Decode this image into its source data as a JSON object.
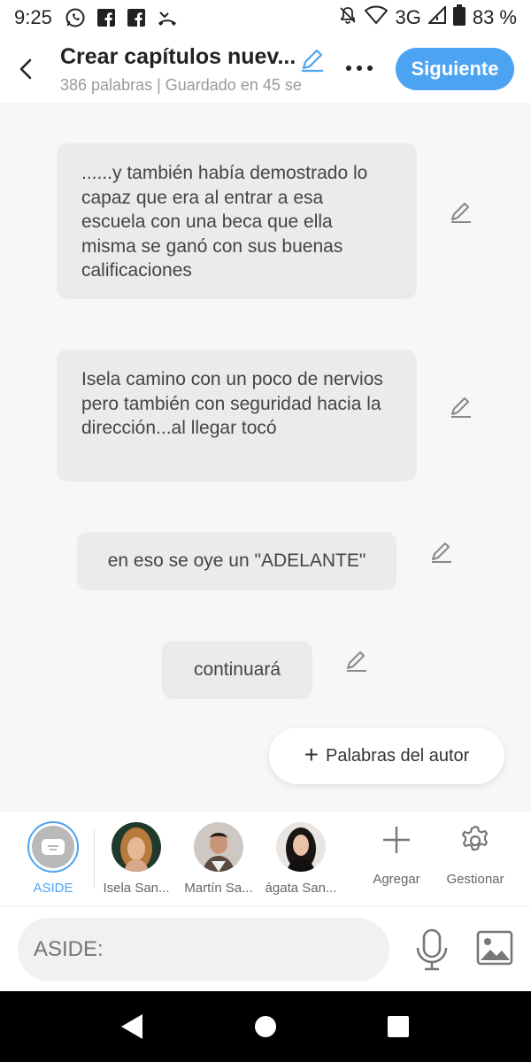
{
  "status_bar": {
    "time": "9:25",
    "network": "3G",
    "battery": "83 %"
  },
  "header": {
    "title": "Crear capítulos nuev...",
    "subtitle": "386 palabras | Guardado en 45 se",
    "next_label": "Siguiente"
  },
  "messages": [
    {
      "text": "......y también había demostrado lo capaz que era al entrar a esa escuela con una beca que ella misma se ganó con sus buenas calificaciones"
    },
    {
      "text": "Isela camino con un poco de nervios pero también con seguridad hacia la dirección...al llegar tocó"
    },
    {
      "text": "en eso se oye un \"ADELANTE\""
    },
    {
      "text": "continuará"
    }
  ],
  "author_words_button": "Palabras del autor",
  "characters": [
    {
      "label": "ASIDE",
      "active": true
    },
    {
      "label": "Isela San..."
    },
    {
      "label": "Martín Sa..."
    },
    {
      "label": "ágata San..."
    }
  ],
  "actions": {
    "add_label": "Agregar",
    "manage_label": "Gestionar"
  },
  "input": {
    "placeholder": "ASIDE:"
  },
  "colors": {
    "accent": "#4ba3f2",
    "bubble": "#ebebeb",
    "background": "#f7f7f7"
  }
}
